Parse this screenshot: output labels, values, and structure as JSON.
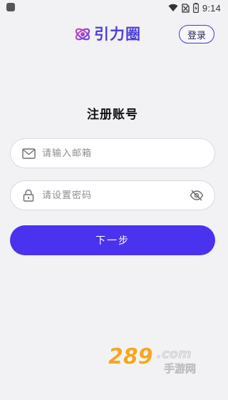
{
  "status_bar": {
    "time": "9:14",
    "icons": [
      "wifi-icon",
      "no-sim-icon",
      "battery-icon"
    ]
  },
  "header": {
    "brand_name": "引力圈",
    "login_label": "登录",
    "brand_color": "#4a3fd8"
  },
  "form": {
    "title": "注册账号",
    "email_placeholder": "请输入邮箱",
    "password_placeholder": "请设置密码",
    "next_label": "下一步",
    "accent_color": "#4a32ee"
  },
  "watermark": {
    "number_text": "289",
    "com_text": ".com",
    "cn_text": "手游网"
  }
}
